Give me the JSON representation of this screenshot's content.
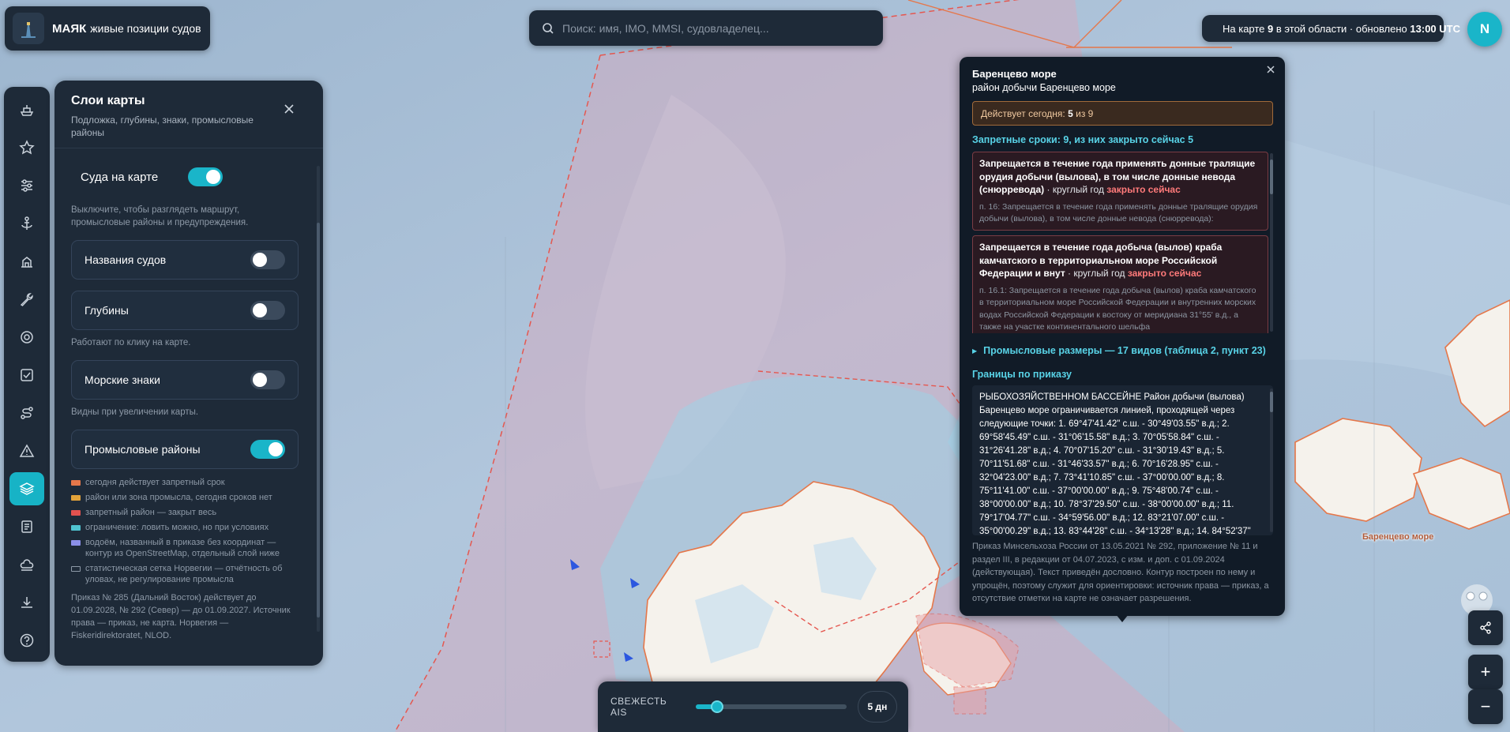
{
  "brand": {
    "name": "МАЯК",
    "subtitle": "живые позиции судов"
  },
  "search": {
    "placeholder": "Поиск: имя, IMO, MMSI, судовладелец..."
  },
  "status": {
    "prefix": "На карте",
    "count": "9",
    "middle": "в этой области · обновлено",
    "time": "13:00 UTC",
    "dot_color": "#2fd39a"
  },
  "user": {
    "initial": "N"
  },
  "rail": {
    "items": [
      {
        "icon": "ship-icon",
        "active": false
      },
      {
        "icon": "star-icon",
        "active": false
      },
      {
        "icon": "sliders-icon",
        "active": false
      },
      {
        "icon": "anchor-icon",
        "active": false
      },
      {
        "icon": "port-icon",
        "active": false
      },
      {
        "icon": "wrench-icon",
        "active": false
      },
      {
        "icon": "target-icon",
        "active": false
      },
      {
        "icon": "checklist-icon",
        "active": false
      },
      {
        "icon": "route-icon",
        "active": false
      },
      {
        "icon": "warning-icon",
        "active": false
      },
      {
        "icon": "layers-icon",
        "active": true
      },
      {
        "icon": "notes-icon",
        "active": false
      },
      {
        "icon": "weather-icon",
        "active": false
      },
      {
        "icon": "download-icon",
        "active": false
      },
      {
        "icon": "help-icon",
        "active": false
      }
    ]
  },
  "layers": {
    "title": "Слои карты",
    "subtitle": "Подложка, глубины, знаки, промысловые районы",
    "ships": {
      "label": "Суда на карте",
      "on": true
    },
    "ships_hint": "Выключите, чтобы разглядеть маршрут, промысловые районы и предупреждения.",
    "names": {
      "label": "Названия судов",
      "on": false
    },
    "depths": {
      "label": "Глубины",
      "on": false
    },
    "depths_hint": "Работают по клику на карте.",
    "marks": {
      "label": "Морские знаки",
      "on": false
    },
    "marks_hint": "Видны при увеличении карты.",
    "fishing": {
      "label": "Промысловые районы",
      "on": true
    },
    "legend": [
      {
        "color": "#e5774a",
        "text": "сегодня действует запретный срок"
      },
      {
        "color": "#e3a33a",
        "text": "район или зона промысла, сегодня сроков нет"
      },
      {
        "color": "#e2524f",
        "text": "запретный район — закрыт весь"
      },
      {
        "color": "#4fc3cf",
        "text": "ограничение: ловить можно, но при условиях"
      },
      {
        "color": "#8b8fe8",
        "text": "водоём, названный в приказе без координат — контур из OpenStreetMap, отдельный слой ниже"
      },
      {
        "color": "transparent",
        "text": "статистическая сетка Норвегии — отчётность об уловах, не регулирование промысла"
      }
    ],
    "footer": "Приказ № 285 (Дальний Восток) действует до 01.09.2028, № 292 (Север) — до 01.09.2027. Источник права — приказ, не карта. Норвегия — Fiskeridirektoratet, NLOD."
  },
  "info": {
    "title": "Баренцево море",
    "subtitle": "район добычи Баренцево море",
    "today_prefix": "Действует сегодня:",
    "today_value": "5",
    "today_suffix": "из 9",
    "bans_header": "Запретные сроки: 9, из них закрыто сейчас 5",
    "bans": [
      {
        "title": "Запрещается в течение года применять донные тралящие орудия добычи (вылова), в том числе донные невода (снюрревода)",
        "meta": " · круглый год ",
        "status": "закрыто сейчас",
        "text": "п. 16: Запрещается в течение года применять донные тралящие орудия добычи (вылова), в том числе донные невода (снюрревода):"
      },
      {
        "title": "Запрещается в течение года добыча (вылов) краба камчатского в территориальном море Российской Федерации и внут",
        "meta": " · круглый год ",
        "status": "закрыто сейчас",
        "text": "п. 16.1: Запрещается в течение года добыча (вылов) краба камчатского в территориальном море Российской Федерации и внутренних морских водах Российской Федерации к востоку от меридиана 31°55' в.д., а также на участке континентального шельфа"
      }
    ],
    "sizes": "Промысловые размеры — 17 видов (таблица 2, пункт 23)",
    "bounds_header": "Границы по приказу",
    "bounds_text": "РЫБОХОЗЯЙСТВЕННОМ БАССЕЙНЕ Район добычи (вылова) Баренцево море ограничивается линией, проходящей через следующие точки: 1. 69°47'41.42\" с.ш. - 30°49'03.55\" в.д.; 2. 69°58'45.49\" с.ш. - 31°06'15.58\" в.д.; 3. 70°05'58.84\" с.ш. - 31°26'41.28\" в.д.; 4. 70°07'15.20\" с.ш. - 31°30'19.43\" в.д.; 5. 70°11'51.68\" с.ш. - 31°46'33.57\" в.д.; 6. 70°16'28.95\" с.ш. - 32°04'23.00\" в.д.; 7. 73°41'10.85\" с.ш. - 37°00'00.00\" в.д.; 8. 75°11'41.00\" с.ш. - 37°00'00.00\" в.д.; 9. 75°48'00.74\" с.ш. - 38°00'00.00\" в.д.; 10. 78°37'29.50\" с.ш. - 38°00'00.00\" в.д.; 11. 79°17'04.77\" с.ш. - 34°59'56.00\" в.д.; 12. 83°21'07.00\" с.ш. - 35°00'00.29\" в.д.; 13. 83°44'28\" с.ш. - 34°13'28\" в.д.; 14. 84°52'37\"",
    "footer": "Приказ Минсельхоза России от 13.05.2021 № 292, приложение № 11 и раздел III, в редакции от 04.07.2023, с изм. и доп. с 01.09.2024 (действующая). Текст приведён дословно. Контур построен по нему и упрощён, поэтому служит для ориентировки: источник права — приказ, а отсутствие отметки на карте не означает разрешения."
  },
  "ais": {
    "label": "СВЕЖЕСТЬ AIS",
    "value_fraction": 0.14,
    "days": "5 дн"
  },
  "map": {
    "region_label": "Баренцево море",
    "zoom_in": "+",
    "zoom_out": "−"
  },
  "colors": {
    "accent": "#1ab5c9",
    "panel": "#1e2a38",
    "danger": "#ff7a7a",
    "zone": "#e5574f"
  }
}
